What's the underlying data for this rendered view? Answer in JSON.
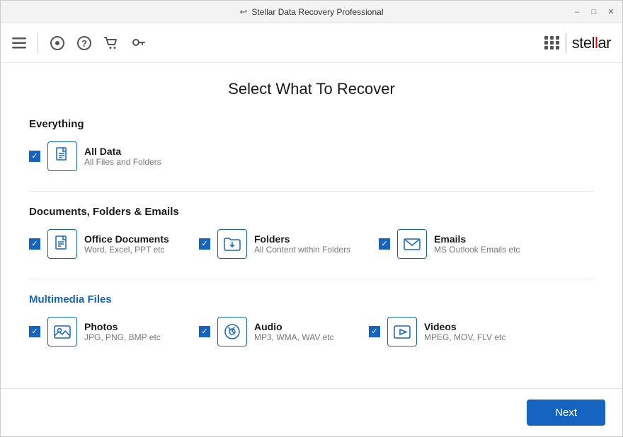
{
  "window": {
    "title": "Stellar Data Recovery Professional",
    "back_icon": "↩",
    "min_btn": "–",
    "restore_btn": "□",
    "close_btn": "✕"
  },
  "toolbar": {
    "menu_icon": "☰",
    "history_icon": "⊙",
    "help_icon": "?",
    "cart_icon": "🛒",
    "key_icon": "🔑",
    "logo_text_prefix": "stel",
    "logo_text_highlight": "l",
    "logo_text_suffix": "ar"
  },
  "page": {
    "title": "Select What To Recover",
    "sections": [
      {
        "id": "everything",
        "label": "Everything",
        "color": "normal",
        "items": [
          {
            "id": "all-data",
            "label": "All Data",
            "sublabel": "All Files and Folders",
            "checked": true,
            "icon": "file"
          }
        ]
      },
      {
        "id": "documents",
        "label": "Documents, Folders & Emails",
        "color": "normal",
        "items": [
          {
            "id": "office",
            "label": "Office Documents",
            "sublabel": "Word, Excel, PPT etc",
            "checked": true,
            "icon": "document"
          },
          {
            "id": "folders",
            "label": "Folders",
            "sublabel": "All Content within Folders",
            "checked": true,
            "icon": "folder"
          },
          {
            "id": "emails",
            "label": "Emails",
            "sublabel": "MS Outlook Emails etc",
            "checked": true,
            "icon": "email"
          }
        ]
      },
      {
        "id": "multimedia",
        "label": "Multimedia Files",
        "color": "blue",
        "items": [
          {
            "id": "photos",
            "label": "Photos",
            "sublabel": "JPG, PNG, BMP etc",
            "checked": true,
            "icon": "photo"
          },
          {
            "id": "audio",
            "label": "Audio",
            "sublabel": "MP3, WMA, WAV etc",
            "checked": true,
            "icon": "audio"
          },
          {
            "id": "videos",
            "label": "Videos",
            "sublabel": "MPEG, MOV, FLV etc",
            "checked": true,
            "icon": "video"
          }
        ]
      }
    ]
  },
  "footer": {
    "next_label": "Next"
  }
}
